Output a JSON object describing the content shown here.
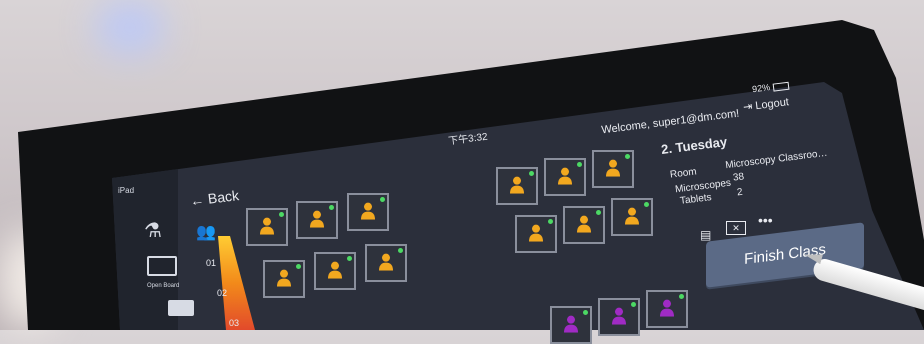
{
  "status_bar": {
    "time": "下午3:32",
    "battery": "92%"
  },
  "header": {
    "welcome": "Welcome, super1@dm.com!",
    "logout_label": "Logout"
  },
  "sidebar": {
    "device_label": "iPad",
    "items": [
      {
        "icon": "microscope-icon",
        "label": ""
      },
      {
        "icon": "screen-icon",
        "label": "Open Board"
      },
      {
        "icon": "monitor-icon",
        "label": ""
      }
    ]
  },
  "nav": {
    "back_label": "Back"
  },
  "level_ticks": [
    "01",
    "02",
    "03"
  ],
  "class_info": {
    "title": "2. Tuesday",
    "room_label": "Room",
    "room_value": "Microscopy Classroo…",
    "microscopes_label": "Microscopes",
    "microscopes_value": "38",
    "tablets_label": "Tablets",
    "tablets_value": "2",
    "more_label": "•••",
    "finish_label": "Finish Class"
  },
  "colors": {
    "seat_active": "#f2a81f",
    "seat_alt": "#a02bc4",
    "status_online": "#4cd964"
  }
}
